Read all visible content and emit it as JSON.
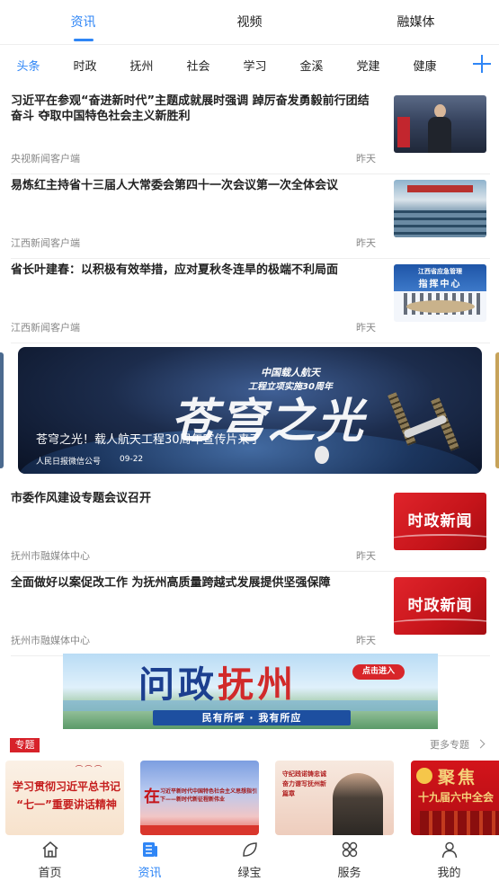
{
  "top_tabs": [
    "资讯",
    "视频",
    "融媒体"
  ],
  "categories": [
    "头条",
    "时政",
    "抚州",
    "社会",
    "学习",
    "金溪",
    "党建",
    "健康"
  ],
  "news": [
    {
      "title": "习近平在参观“奋进新时代”主题成就展时强调 踔厉奋发勇毅前行团结奋斗 夺取中国特色社会主义新胜利",
      "source": "央视新闻客户端",
      "time": "昨天"
    },
    {
      "title": "易炼红主持省十三届人大常委会第四十一次会议第一次全体会议",
      "source": "江西新闻客户端",
      "time": "昨天"
    },
    {
      "title": "省长叶建春：以积极有效举措，应对夏秋冬连旱的极端不利局面",
      "source": "江西新闻客户端",
      "time": "昨天",
      "thumb_line1": "江西省应急管理",
      "thumb_line2": "指挥中心"
    },
    {
      "title": "市委作风建设专题会议召开",
      "source": "抚州市融媒体中心",
      "time": "昨天",
      "thumb_text": "时政新闻"
    },
    {
      "title": "全面做好以案促改工作 为抚州高质量跨越式发展提供坚强保障",
      "source": "抚州市融媒体中心",
      "time": "昨天",
      "thumb_text": "时政新闻"
    }
  ],
  "carousel": {
    "brand_line1": "中国载人航天",
    "brand_line2": "工程立项实施30周年",
    "calligraphy": "苍穹之光",
    "caption": "苍穹之光！载人航天工程30周年宣传片来了",
    "source": "人民日报微信公号",
    "date": "09-22"
  },
  "ad": {
    "title_a": "问政",
    "title_b": "抚州",
    "enter_label": "点击进入",
    "slogan": "民有所呼 · 我有所应"
  },
  "topics": {
    "tag": "专题",
    "more_label": "更多专题",
    "cards": [
      {
        "line1": "学习贯彻习近平总书记",
        "line2": "“七一”重要讲话精神"
      },
      {
        "big": "在",
        "text": "习近平新时代中国特色社会主义思想指引下——新时代新征程新伟业"
      },
      {
        "text": "守纪践诺铸忠诚 奋力谱写抚州新篇章"
      },
      {
        "line1": "聚焦",
        "line2": "十九届六中全会"
      }
    ]
  },
  "bottom_nav": [
    "首页",
    "资讯",
    "绿宝",
    "服务",
    "我的"
  ],
  "colors": {
    "accent": "#2f86f6",
    "red": "#d7222a"
  }
}
